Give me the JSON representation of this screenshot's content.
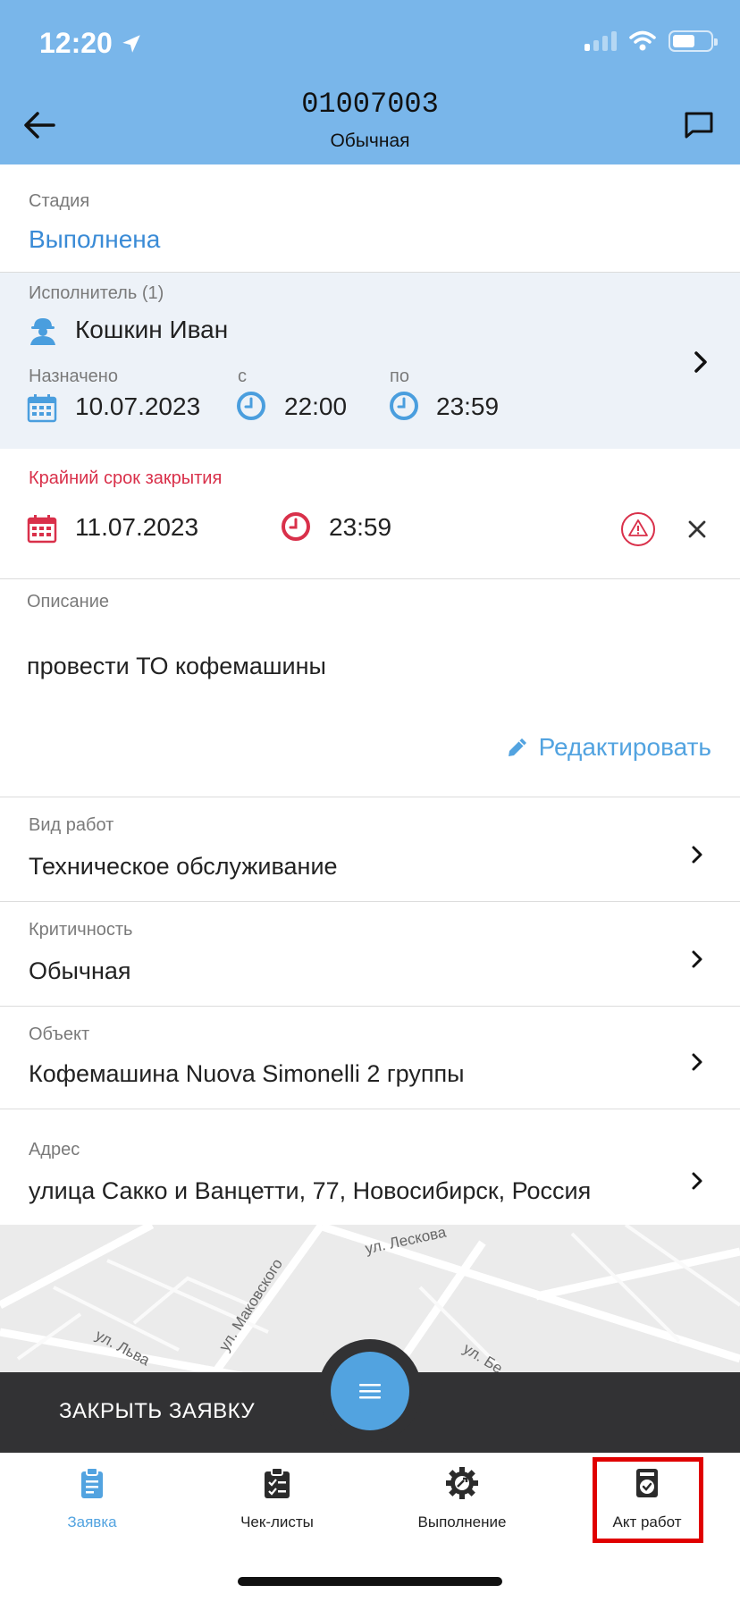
{
  "status_bar": {
    "time": "12:20"
  },
  "header": {
    "request_number": "01007003",
    "priority": "Обычная"
  },
  "stage": {
    "label": "Стадия",
    "value": "Выполнена"
  },
  "executor": {
    "label": "Исполнитель (1)",
    "name": "Кошкин Иван",
    "assigned_label": "Назначено",
    "assigned_date": "10.07.2023",
    "from_label": "с",
    "from_time": "22:00",
    "to_label": "по",
    "to_time": "23:59"
  },
  "deadline": {
    "label": "Крайний срок закрытия",
    "date": "11.07.2023",
    "time": "23:59"
  },
  "description": {
    "label": "Описание",
    "text": "провести ТО кофемашины",
    "edit_label": "Редактировать"
  },
  "work_type": {
    "label": "Вид работ",
    "value": "Техническое обслуживание"
  },
  "criticality": {
    "label": "Критичность",
    "value": "Обычная"
  },
  "object": {
    "label": "Объект",
    "value": "Кофемашина Nuova Simonelli 2 группы"
  },
  "address": {
    "label": "Адрес",
    "value": "улица Сакко и Ванцетти, 77, Новосибирск, Россия"
  },
  "map": {
    "streets": [
      "ул. Лескова",
      "ул. Маковского",
      "ул. Льва",
      "ул. Бе"
    ]
  },
  "actions": {
    "close_request": "ЗАКРЫТЬ ЗАЯВКУ"
  },
  "tabs": [
    {
      "label": "Заявка",
      "icon": "clipboard-icon",
      "active": true
    },
    {
      "label": "Чек-листы",
      "icon": "checklist-icon",
      "active": false
    },
    {
      "label": "Выполнение",
      "icon": "gear-icon",
      "active": false
    },
    {
      "label": "Акт работ",
      "icon": "act-check-icon",
      "active": false
    }
  ],
  "colors": {
    "header": "#79b6ea",
    "accent": "#52a3e0",
    "danger": "#d9304a",
    "dark_bar": "#323234",
    "highlight": "#e00000"
  }
}
